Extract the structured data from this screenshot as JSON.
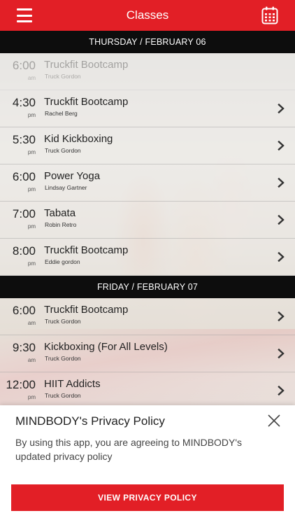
{
  "header": {
    "title": "Classes",
    "accent_color": "#e21f26"
  },
  "days": [
    {
      "label": "THURSDAY / FEBRUARY 06",
      "classes": [
        {
          "time": "6:00",
          "ampm": "am",
          "name": "Truckfit Bootcamp",
          "instructor": "Truck Gordon",
          "faded": true
        },
        {
          "time": "4:30",
          "ampm": "pm",
          "name": "Truckfit Bootcamp",
          "instructor": "Rachel Berg"
        },
        {
          "time": "5:30",
          "ampm": "pm",
          "name": "Kid Kickboxing",
          "instructor": "Truck Gordon"
        },
        {
          "time": "6:00",
          "ampm": "pm",
          "name": "Power Yoga",
          "instructor": "Lindsay Gartner"
        },
        {
          "time": "7:00",
          "ampm": "pm",
          "name": "Tabata",
          "instructor": "Robin Retro"
        },
        {
          "time": "8:00",
          "ampm": "pm",
          "name": "Truckfit Bootcamp",
          "instructor": "Eddie gordon"
        }
      ]
    },
    {
      "label": "FRIDAY / FEBRUARY 07",
      "classes": [
        {
          "time": "6:00",
          "ampm": "am",
          "name": "Truckfit Bootcamp",
          "instructor": "Truck Gordon"
        },
        {
          "time": "9:30",
          "ampm": "am",
          "name": " Kickboxing (For All Levels)",
          "instructor": "Truck Gordon"
        },
        {
          "time": "12:00",
          "ampm": "pm",
          "name": "HIIT Addicts",
          "instructor": "Truck Gordon"
        }
      ]
    }
  ],
  "privacy": {
    "title": "MINDBODY's Privacy Policy",
    "body": "By using this app, you are agreeing to MINDBODY's updated privacy policy",
    "button_label": "VIEW PRIVACY POLICY"
  }
}
